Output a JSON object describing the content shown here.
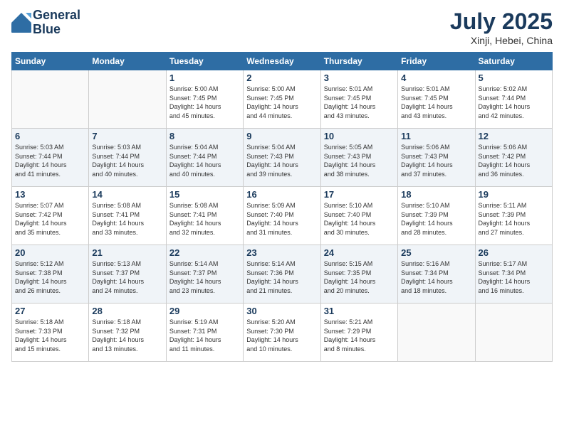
{
  "header": {
    "logo_line1": "General",
    "logo_line2": "Blue",
    "month": "July 2025",
    "location": "Xinji, Hebei, China"
  },
  "days_of_week": [
    "Sunday",
    "Monday",
    "Tuesday",
    "Wednesday",
    "Thursday",
    "Friday",
    "Saturday"
  ],
  "weeks": [
    [
      {
        "day": "",
        "info": ""
      },
      {
        "day": "",
        "info": ""
      },
      {
        "day": "1",
        "info": "Sunrise: 5:00 AM\nSunset: 7:45 PM\nDaylight: 14 hours\nand 45 minutes."
      },
      {
        "day": "2",
        "info": "Sunrise: 5:00 AM\nSunset: 7:45 PM\nDaylight: 14 hours\nand 44 minutes."
      },
      {
        "day": "3",
        "info": "Sunrise: 5:01 AM\nSunset: 7:45 PM\nDaylight: 14 hours\nand 43 minutes."
      },
      {
        "day": "4",
        "info": "Sunrise: 5:01 AM\nSunset: 7:45 PM\nDaylight: 14 hours\nand 43 minutes."
      },
      {
        "day": "5",
        "info": "Sunrise: 5:02 AM\nSunset: 7:44 PM\nDaylight: 14 hours\nand 42 minutes."
      }
    ],
    [
      {
        "day": "6",
        "info": "Sunrise: 5:03 AM\nSunset: 7:44 PM\nDaylight: 14 hours\nand 41 minutes."
      },
      {
        "day": "7",
        "info": "Sunrise: 5:03 AM\nSunset: 7:44 PM\nDaylight: 14 hours\nand 40 minutes."
      },
      {
        "day": "8",
        "info": "Sunrise: 5:04 AM\nSunset: 7:44 PM\nDaylight: 14 hours\nand 40 minutes."
      },
      {
        "day": "9",
        "info": "Sunrise: 5:04 AM\nSunset: 7:43 PM\nDaylight: 14 hours\nand 39 minutes."
      },
      {
        "day": "10",
        "info": "Sunrise: 5:05 AM\nSunset: 7:43 PM\nDaylight: 14 hours\nand 38 minutes."
      },
      {
        "day": "11",
        "info": "Sunrise: 5:06 AM\nSunset: 7:43 PM\nDaylight: 14 hours\nand 37 minutes."
      },
      {
        "day": "12",
        "info": "Sunrise: 5:06 AM\nSunset: 7:42 PM\nDaylight: 14 hours\nand 36 minutes."
      }
    ],
    [
      {
        "day": "13",
        "info": "Sunrise: 5:07 AM\nSunset: 7:42 PM\nDaylight: 14 hours\nand 35 minutes."
      },
      {
        "day": "14",
        "info": "Sunrise: 5:08 AM\nSunset: 7:41 PM\nDaylight: 14 hours\nand 33 minutes."
      },
      {
        "day": "15",
        "info": "Sunrise: 5:08 AM\nSunset: 7:41 PM\nDaylight: 14 hours\nand 32 minutes."
      },
      {
        "day": "16",
        "info": "Sunrise: 5:09 AM\nSunset: 7:40 PM\nDaylight: 14 hours\nand 31 minutes."
      },
      {
        "day": "17",
        "info": "Sunrise: 5:10 AM\nSunset: 7:40 PM\nDaylight: 14 hours\nand 30 minutes."
      },
      {
        "day": "18",
        "info": "Sunrise: 5:10 AM\nSunset: 7:39 PM\nDaylight: 14 hours\nand 28 minutes."
      },
      {
        "day": "19",
        "info": "Sunrise: 5:11 AM\nSunset: 7:39 PM\nDaylight: 14 hours\nand 27 minutes."
      }
    ],
    [
      {
        "day": "20",
        "info": "Sunrise: 5:12 AM\nSunset: 7:38 PM\nDaylight: 14 hours\nand 26 minutes."
      },
      {
        "day": "21",
        "info": "Sunrise: 5:13 AM\nSunset: 7:37 PM\nDaylight: 14 hours\nand 24 minutes."
      },
      {
        "day": "22",
        "info": "Sunrise: 5:14 AM\nSunset: 7:37 PM\nDaylight: 14 hours\nand 23 minutes."
      },
      {
        "day": "23",
        "info": "Sunrise: 5:14 AM\nSunset: 7:36 PM\nDaylight: 14 hours\nand 21 minutes."
      },
      {
        "day": "24",
        "info": "Sunrise: 5:15 AM\nSunset: 7:35 PM\nDaylight: 14 hours\nand 20 minutes."
      },
      {
        "day": "25",
        "info": "Sunrise: 5:16 AM\nSunset: 7:34 PM\nDaylight: 14 hours\nand 18 minutes."
      },
      {
        "day": "26",
        "info": "Sunrise: 5:17 AM\nSunset: 7:34 PM\nDaylight: 14 hours\nand 16 minutes."
      }
    ],
    [
      {
        "day": "27",
        "info": "Sunrise: 5:18 AM\nSunset: 7:33 PM\nDaylight: 14 hours\nand 15 minutes."
      },
      {
        "day": "28",
        "info": "Sunrise: 5:18 AM\nSunset: 7:32 PM\nDaylight: 14 hours\nand 13 minutes."
      },
      {
        "day": "29",
        "info": "Sunrise: 5:19 AM\nSunset: 7:31 PM\nDaylight: 14 hours\nand 11 minutes."
      },
      {
        "day": "30",
        "info": "Sunrise: 5:20 AM\nSunset: 7:30 PM\nDaylight: 14 hours\nand 10 minutes."
      },
      {
        "day": "31",
        "info": "Sunrise: 5:21 AM\nSunset: 7:29 PM\nDaylight: 14 hours\nand 8 minutes."
      },
      {
        "day": "",
        "info": ""
      },
      {
        "day": "",
        "info": ""
      }
    ]
  ]
}
